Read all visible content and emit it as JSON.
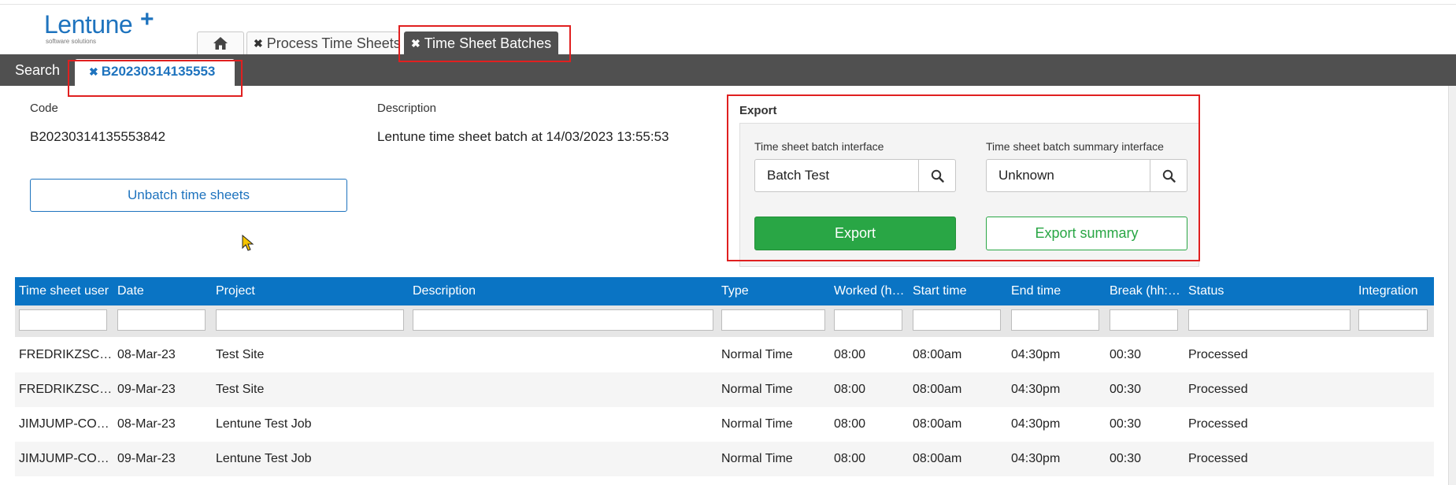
{
  "logo": {
    "word": "Lentune",
    "plus": "+",
    "sub": "software solutions"
  },
  "top_tabs": {
    "home_icon": "home-icon",
    "process_time_sheets": {
      "close": "✖",
      "label": "Process Time Sheets"
    },
    "time_sheet_batches": {
      "close": "✖",
      "label": "Time Sheet Batches"
    }
  },
  "subnav": {
    "search": "Search",
    "batch_tab": {
      "close": "✖",
      "label": "B20230314135553"
    }
  },
  "form": {
    "code_label": "Code",
    "code_value": "B20230314135553842",
    "description_label": "Description",
    "description_value": "Lentune time sheet batch at 14/03/2023 13:55:53",
    "unbatch_button": "Unbatch time sheets"
  },
  "export": {
    "title": "Export",
    "interface_label": "Time sheet batch interface",
    "interface_value": "Batch Test",
    "summary_interface_label": "Time sheet batch summary interface",
    "summary_interface_value": "Unknown",
    "export_button": "Export",
    "export_summary_button": "Export summary"
  },
  "grid": {
    "columns": [
      "Time sheet user",
      "Date",
      "Project",
      "Description",
      "Type",
      "Worked (hh:mm)",
      "Start time",
      "End time",
      "Break (hh:mm)",
      "Status",
      "Integration"
    ],
    "rows": [
      [
        "FREDRIKZSCHUMACHER",
        "08-Mar-23",
        "Test Site",
        "",
        "Normal Time",
        "08:00",
        "08:00am",
        "04:30pm",
        "00:30",
        "Processed",
        ""
      ],
      [
        "FREDRIKZSCHUMACHER",
        "09-Mar-23",
        "Test Site",
        "",
        "Normal Time",
        "08:00",
        "08:00am",
        "04:30pm",
        "00:30",
        "Processed",
        ""
      ],
      [
        "JIMJUMP-CONSULTING",
        "08-Mar-23",
        "Lentune Test Job",
        "",
        "Normal Time",
        "08:00",
        "08:00am",
        "04:30pm",
        "00:30",
        "Processed",
        ""
      ],
      [
        "JIMJUMP-CONSULTING",
        "09-Mar-23",
        "Lentune Test Job",
        "",
        "Normal Time",
        "08:00",
        "08:00am",
        "04:30pm",
        "00:30",
        "Processed",
        ""
      ]
    ]
  },
  "colors": {
    "brand_blue": "#1e73be",
    "header_blue": "#0a74c4",
    "dark_bar": "#505050",
    "green": "#29a645",
    "annotation_red": "#e02020"
  }
}
